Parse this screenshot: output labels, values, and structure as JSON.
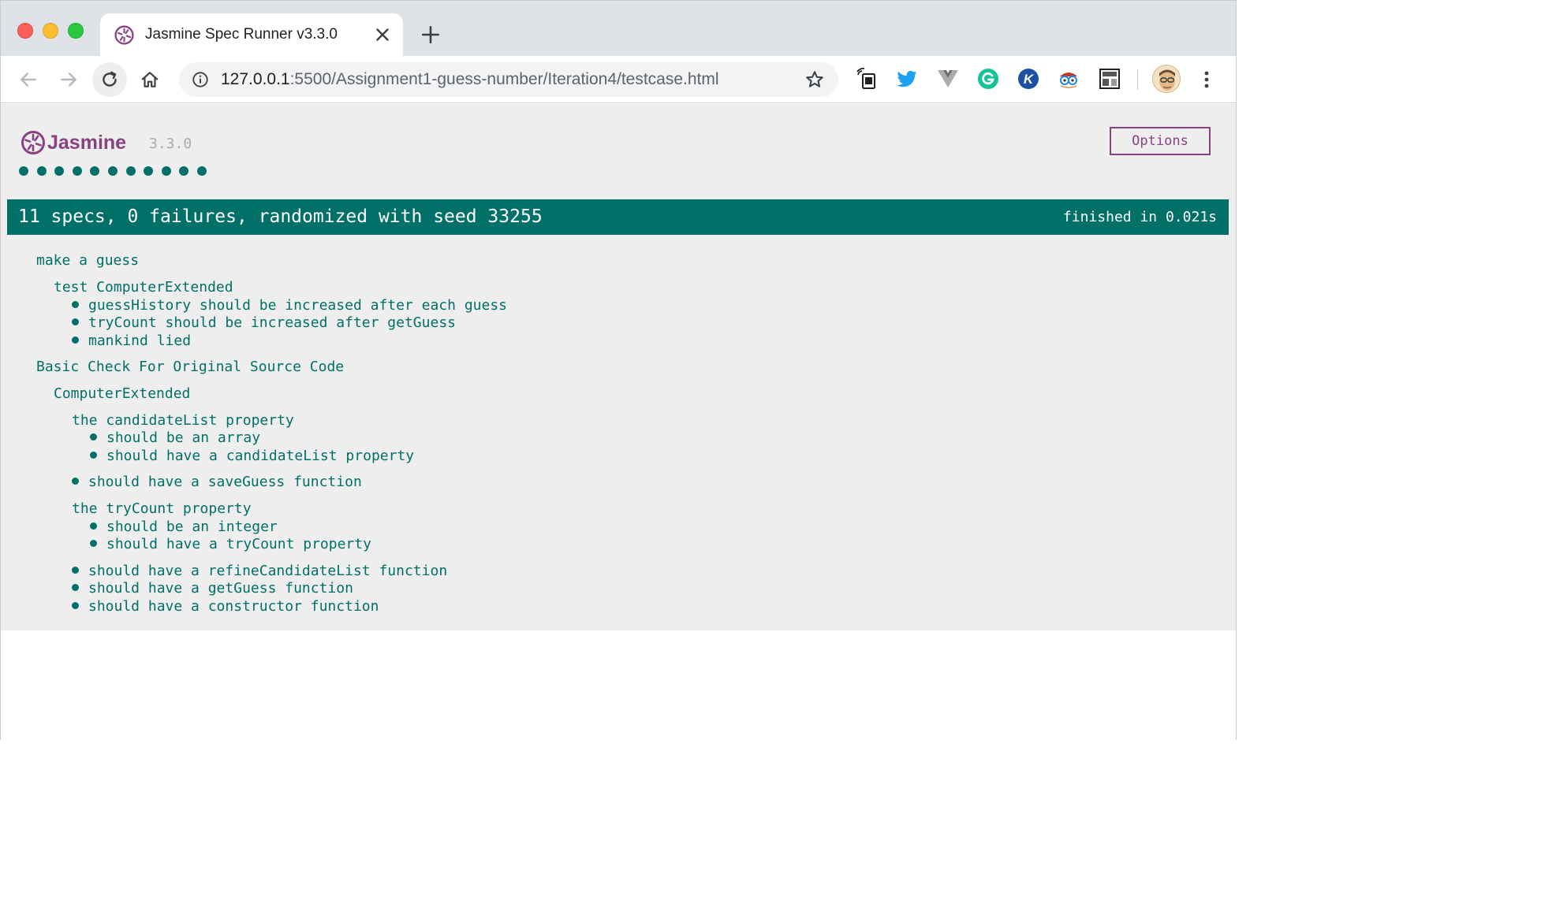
{
  "browser": {
    "tab_title": "Jasmine Spec Runner v3.3.0",
    "url_host": "127.0.0.1",
    "url_rest": ":5500/Assignment1-guess-number/Iteration4/testcase.html"
  },
  "jasmine": {
    "brand": "Jasmine",
    "version": "3.3.0",
    "options_label": "Options",
    "spec_dot_count": 11,
    "summary": "11 specs, 0 failures, randomized with seed 33255",
    "duration": "finished in 0.021s",
    "colors": {
      "passed": "#007069",
      "brand": "#8a4182",
      "background": "#eeeeee"
    }
  },
  "results": {
    "suite1": {
      "title": "make a guess",
      "sub1": {
        "title": "test ComputerExtended",
        "specs": [
          "guessHistory should be increased after each guess",
          "tryCount should be increased after getGuess",
          "mankind lied"
        ]
      }
    },
    "suite2": {
      "title": "Basic Check For Original Source Code",
      "sub1": {
        "title": "ComputerExtended",
        "candidate": {
          "title": "the candidateList property",
          "specs": [
            "should be an array",
            "should have a candidateList property"
          ]
        },
        "spec_save": "should have a saveGuess function",
        "trycount": {
          "title": "the tryCount property",
          "specs": [
            "should be an integer",
            "should have a tryCount property"
          ]
        },
        "specs_tail": [
          "should have a refineCandidateList function",
          "should have a getGuess function",
          "should have a constructor function"
        ]
      }
    }
  },
  "icons": [
    "back-arrow-icon",
    "forward-arrow-icon",
    "reload-icon",
    "home-icon",
    "info-icon",
    "star-icon",
    "cast-icon",
    "twitter-icon",
    "vue-icon",
    "grammarly-icon",
    "k-icon",
    "glasses-icon",
    "layout-icon",
    "kebab-menu-icon"
  ]
}
